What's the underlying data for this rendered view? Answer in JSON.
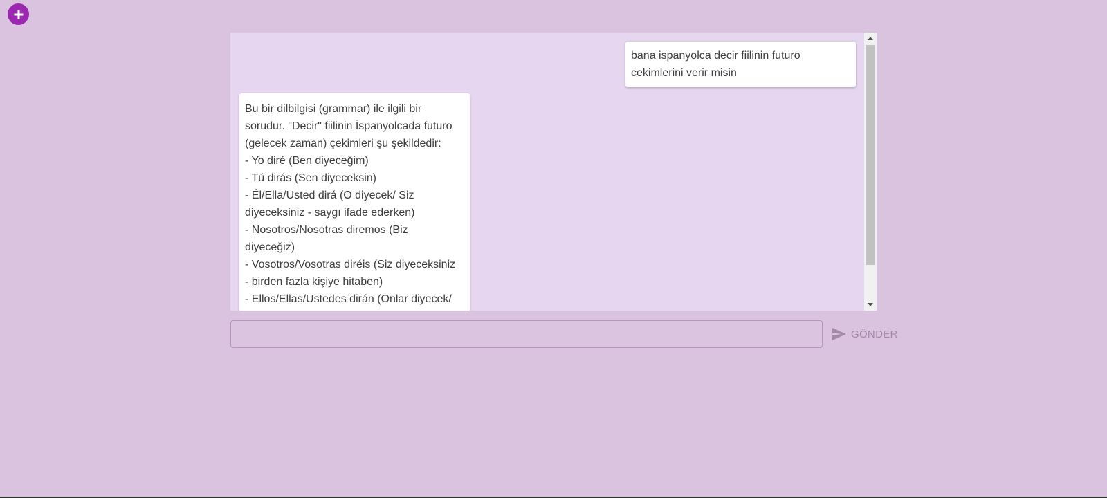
{
  "colors": {
    "page_bg": "#d9c3de",
    "chat_bg": "#e7d6ef",
    "accent": "#9c27b0",
    "send_text": "#a58aa8"
  },
  "toolbar": {
    "add_icon": "plus-icon"
  },
  "chat": {
    "messages": [
      {
        "role": "user",
        "lines": [
          "bana ispanyolca decir fiilinin futuro",
          "cekimlerini verir misin"
        ]
      },
      {
        "role": "assistant",
        "lines": [
          "Bu bir dilbilgisi (grammar) ile ilgili bir",
          "sorudur. \"Decir\" fiilinin İspanyolcada futuro",
          "(gelecek zaman) çekimleri şu şekildedir:",
          "- Yo diré (Ben diyeceğim)",
          "- Tú dirás (Sen diyeceksin)",
          "- Él/Ella/Usted dirá (O diyecek/ Siz",
          "diyeceksiniz - saygı ifade ederken)",
          "- Nosotros/Nosotras diremos (Biz",
          "diyeceğiz)",
          "- Vosotros/Vosotras diréis (Siz diyeceksiniz",
          "- birden fazla kişiye hitaben)",
          "- Ellos/Ellas/Ustedes dirán (Onlar diyecek/"
        ]
      }
    ]
  },
  "composer": {
    "input_value": "",
    "input_placeholder": "",
    "send_label": "GÖNDER",
    "send_icon": "send-icon"
  }
}
